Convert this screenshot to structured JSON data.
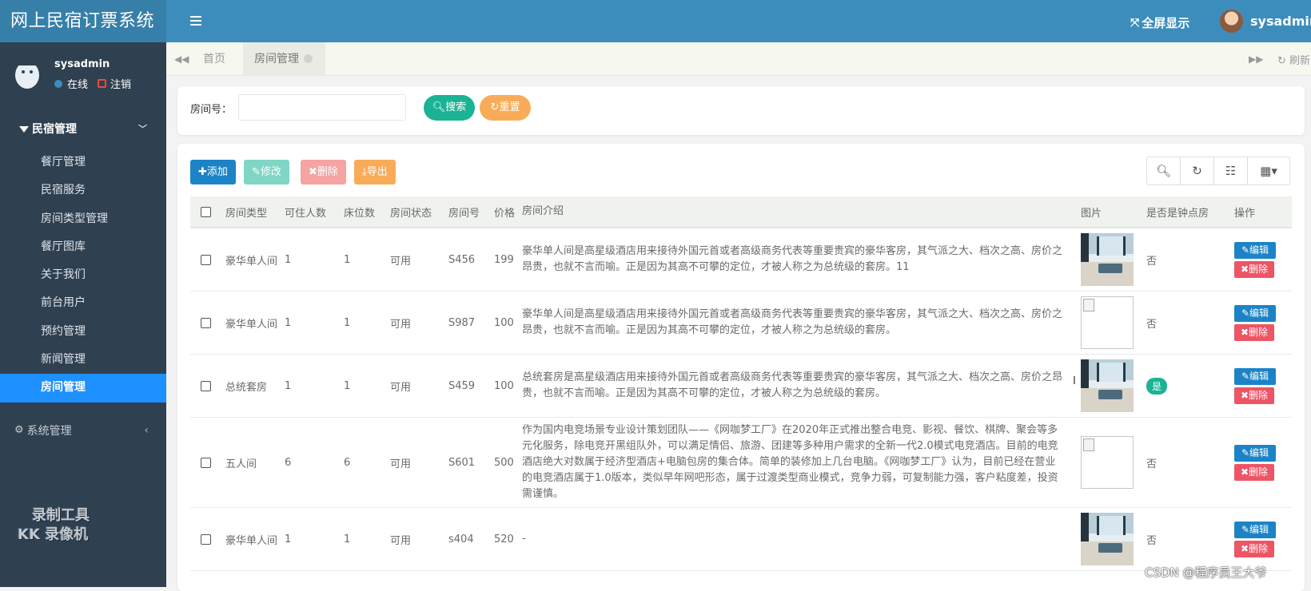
{
  "app": {
    "title": "网上民宿订票系统"
  },
  "sidebar": {
    "user": {
      "name": "sysadmin",
      "status": "在线",
      "logout": "注销"
    },
    "group": {
      "label": "民宿管理"
    },
    "items": [
      {
        "label": "餐厅管理"
      },
      {
        "label": "民宿服务"
      },
      {
        "label": "房间类型管理"
      },
      {
        "label": "餐厅图库"
      },
      {
        "label": "关于我们"
      },
      {
        "label": "前台用户"
      },
      {
        "label": "预约管理"
      },
      {
        "label": "新闻管理"
      },
      {
        "label": "房间管理",
        "active": true
      }
    ],
    "system_group": {
      "label": "系统管理"
    },
    "watermark": {
      "line1": "录制工具",
      "line2": "KK 录像机"
    }
  },
  "topbar": {
    "fullscreen": "全屏显示",
    "user": "sysadmin"
  },
  "tabs": {
    "home": "首页",
    "current": "房间管理",
    "refresh": "刷新"
  },
  "search": {
    "room_label": "房间号：",
    "room_value": "",
    "search_btn": "搜索",
    "reset_btn": "重置"
  },
  "toolbar": {
    "add": "添加",
    "edit": "修改",
    "delete": "删除",
    "export": "导出"
  },
  "table": {
    "headers": [
      "房间类型",
      "可住人数",
      "床位数",
      "房间状态",
      "房间号",
      "价格",
      "房间介绍",
      "图片",
      "是否是钟点房",
      "操作"
    ],
    "edit_label": "编辑",
    "delete_label": "删除",
    "rows": [
      {
        "type": "豪华单人间",
        "capacity": "1",
        "beds": "1",
        "status": "可用",
        "room_no": "S456",
        "price": "199",
        "intro": "豪华单人间是高星级酒店用来接待外国元首或者高级商务代表等重要贵宾的豪华客房，其气派之大、档次之高、房价之昂贵，也就不言而喻。正是因为其高不可攀的定位，才被人称之为总统级的套房。11",
        "image": "photo",
        "hourly": "否"
      },
      {
        "type": "豪华单人间",
        "capacity": "1",
        "beds": "1",
        "status": "可用",
        "room_no": "S987",
        "price": "100",
        "intro": "豪华单人间是高星级酒店用来接待外国元首或者高级商务代表等重要贵宾的豪华客房，其气派之大、档次之高、房价之昂贵，也就不言而喻。正是因为其高不可攀的定位，才被人称之为总统级的套房。",
        "image": "broken",
        "hourly": "否"
      },
      {
        "type": "总统套房",
        "capacity": "1",
        "beds": "1",
        "status": "可用",
        "room_no": "S459",
        "price": "100",
        "intro": "总统套房是高星级酒店用来接待外国元首或者高级商务代表等重要贵宾的豪华客房，其气派之大、档次之高、房价之昂贵，也就不言而喻。正是因为其高不可攀的定位，才被人称之为总统级的套房。",
        "image": "photo",
        "hourly": "是"
      },
      {
        "type": "五人间",
        "capacity": "6",
        "beds": "6",
        "status": "可用",
        "room_no": "S601",
        "price": "500",
        "intro": "作为国内电竞场景专业设计策划团队——《网咖梦工厂》在2020年正式推出整合电竞、影视、餐饮、棋牌、聚会等多元化服务，除电竞开黑组队外，可以满足情侣、旅游、团建等多种用户需求的全新一代2.0模式电竞酒店。目前的电竞酒店绝大对数属于经济型酒店+电脑包房的集合体。简单的装修加上几台电脑。《网咖梦工厂》认为，目前已经在营业的电竞酒店属于1.0版本，类似早年网吧形态，属于过渡类型商业模式，竞争力弱，可复制能力强，客户粘度差，投资需谨慎。",
        "image": "broken",
        "hourly": "否"
      },
      {
        "type": "豪华单人间",
        "capacity": "1",
        "beds": "1",
        "status": "可用",
        "room_no": "s404",
        "price": "520",
        "intro": "-",
        "image": "photo",
        "hourly": "否"
      }
    ]
  },
  "overlay": {
    "csdn": "CSDN @程序员王大爷"
  },
  "colors": {
    "sidebar": "#2f4050",
    "topbar": "#3c8dbc",
    "active": "#1e90ff",
    "primary": "#1c84c6",
    "success": "#1ab394",
    "warning": "#f8ac59",
    "danger": "#ed5565"
  }
}
